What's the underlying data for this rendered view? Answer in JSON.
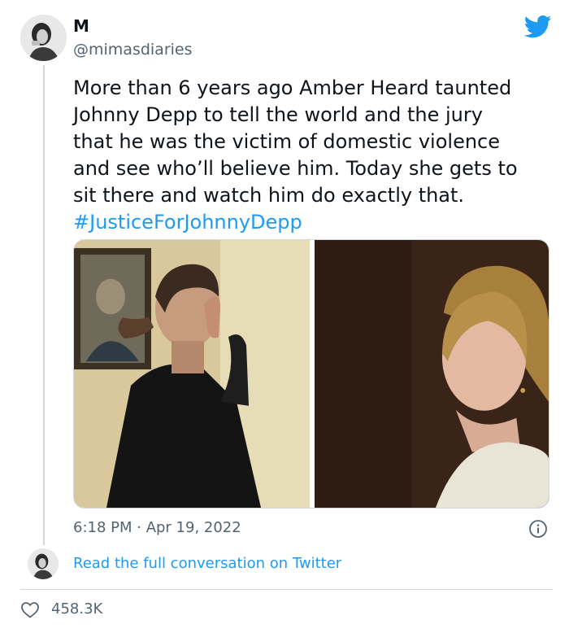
{
  "tweet": {
    "author_name": "M",
    "author_handle": "@mimasdiaries",
    "text_lines": [
      "More than 6 years ago Amber Heard taunted",
      "Johnny Depp to tell the world and the jury",
      "that he was the victim of domestic violence",
      "and see who’ll believe him. Today she gets to",
      "sit there and watch him do exactly that."
    ],
    "hashtag": "#JusticeForJohnnyDepp",
    "timestamp": "6:18 PM · Apr 19, 2022",
    "read_more_link": "Read the full conversation on Twitter",
    "like_count": "458.3K"
  },
  "icons": {
    "brand": "twitter-bird-icon",
    "info": "info-icon",
    "like": "heart-icon"
  },
  "colors": {
    "accent": "#1d9bf0",
    "text": "#0f1419",
    "secondary": "#536471",
    "border": "#cfd9de"
  }
}
